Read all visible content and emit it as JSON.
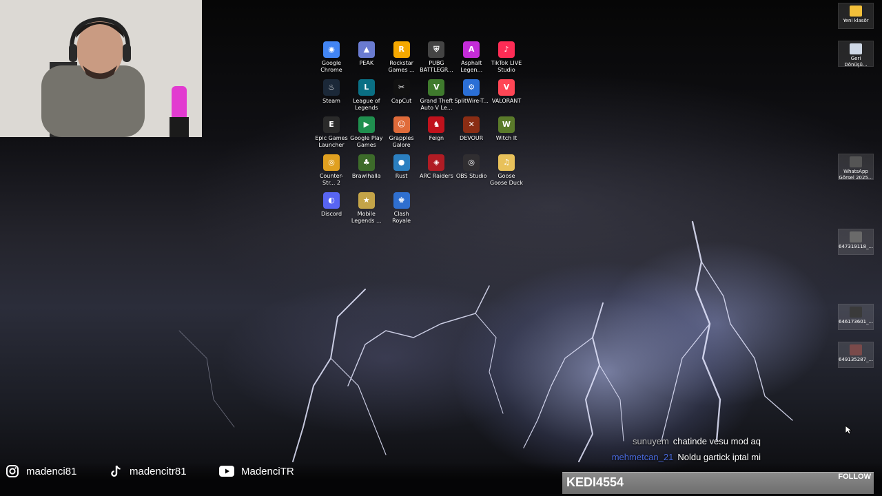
{
  "desktop_icons": [
    {
      "label": "Google Chrome",
      "icon": "chrome-icon",
      "color": "#4285f4"
    },
    {
      "label": "PEAK",
      "icon": "peak-icon",
      "color": "#6a7bd0"
    },
    {
      "label": "Rockstar Games ...",
      "icon": "rockstar-icon",
      "color": "#f5a800"
    },
    {
      "label": "PUBG BATTLEGR...",
      "icon": "pubg-icon",
      "color": "#444444"
    },
    {
      "label": "Asphalt Legen...",
      "icon": "asphalt-icon",
      "color": "#c42cd8"
    },
    {
      "label": "TikTok LIVE Studio",
      "icon": "tiktok-live-icon",
      "color": "#fe2c55"
    },
    {
      "label": "Steam",
      "icon": "steam-icon",
      "color": "#1b2838"
    },
    {
      "label": "League of Legends",
      "icon": "league-icon",
      "color": "#0a6f84"
    },
    {
      "label": "CapCut",
      "icon": "capcut-icon",
      "color": "#111111"
    },
    {
      "label": "Grand Theft Auto V Le...",
      "icon": "gta-icon",
      "color": "#3f7a2d"
    },
    {
      "label": "SplitWire-T...",
      "icon": "splitwire-icon",
      "color": "#2b6fd6"
    },
    {
      "label": "VALORANT",
      "icon": "valorant-icon",
      "color": "#ff4655"
    },
    {
      "label": "Epic Games Launcher",
      "icon": "epic-icon",
      "color": "#2a2a2a"
    },
    {
      "label": "Google Play Games",
      "icon": "play-games-icon",
      "color": "#1f8f4e"
    },
    {
      "label": "Grapples Galore",
      "icon": "grapples-icon",
      "color": "#e06b3a"
    },
    {
      "label": "Feign",
      "icon": "feign-icon",
      "color": "#c0121c"
    },
    {
      "label": "DEVOUR",
      "icon": "devour-icon",
      "color": "#8a2d14"
    },
    {
      "label": "Witch It",
      "icon": "witch-it-icon",
      "color": "#5a7a2a"
    },
    {
      "label": "Counter-Str... 2",
      "icon": "cs2-icon",
      "color": "#e0a020"
    },
    {
      "label": "Brawlhalla",
      "icon": "brawlhalla-icon",
      "color": "#3d6b2a"
    },
    {
      "label": "Rust",
      "icon": "rust-icon",
      "color": "#2b7fc0"
    },
    {
      "label": "ARC Raiders",
      "icon": "arc-raiders-icon",
      "color": "#b01c24"
    },
    {
      "label": "OBS Studio",
      "icon": "obs-icon",
      "color": "#302e31"
    },
    {
      "label": "Goose Goose Duck",
      "icon": "goose-icon",
      "color": "#e8c15a"
    },
    {
      "label": "Discord",
      "icon": "discord-icon",
      "color": "#5865f2"
    },
    {
      "label": "Mobile Legends ...",
      "icon": "mobile-legends-icon",
      "color": "#c4a448"
    },
    {
      "label": "Clash Royale",
      "icon": "clash-royale-icon",
      "color": "#2f6fcf"
    }
  ],
  "right_icons": [
    {
      "label": "Yeni klasör",
      "icon": "folder-icon",
      "color": "#f3c03a"
    },
    {
      "label": "Geri Dönüşü...",
      "icon": "recycle-bin-icon",
      "color": "#cfd8e6"
    },
    {
      "label": "WhatsApp Görsel 2025...",
      "icon": "image-thumbnail-icon",
      "color": "#555555"
    },
    {
      "label": "647319118_...",
      "icon": "image-thumbnail-icon",
      "color": "#6a6a6a"
    },
    {
      "label": "646173601_...",
      "icon": "image-thumbnail-icon",
      "color": "#3a3a3a"
    },
    {
      "label": "649135287_...",
      "icon": "image-thumbnail-icon",
      "color": "#7a4a4a"
    }
  ],
  "socials": [
    {
      "icon": "instagram-icon",
      "handle": "madenci81"
    },
    {
      "icon": "tiktok-icon",
      "handle": "madencitr81"
    },
    {
      "icon": "youtube-icon",
      "handle": "MadenciTR"
    }
  ],
  "chat": [
    {
      "user": "sunuyem",
      "message": "chatinde vesu mod aq"
    },
    {
      "user": "mehmetcan_21",
      "message": "Noldu gartick iptal mi"
    }
  ],
  "alert": {
    "name": "KEDI4554",
    "action": "FOLLOW"
  }
}
